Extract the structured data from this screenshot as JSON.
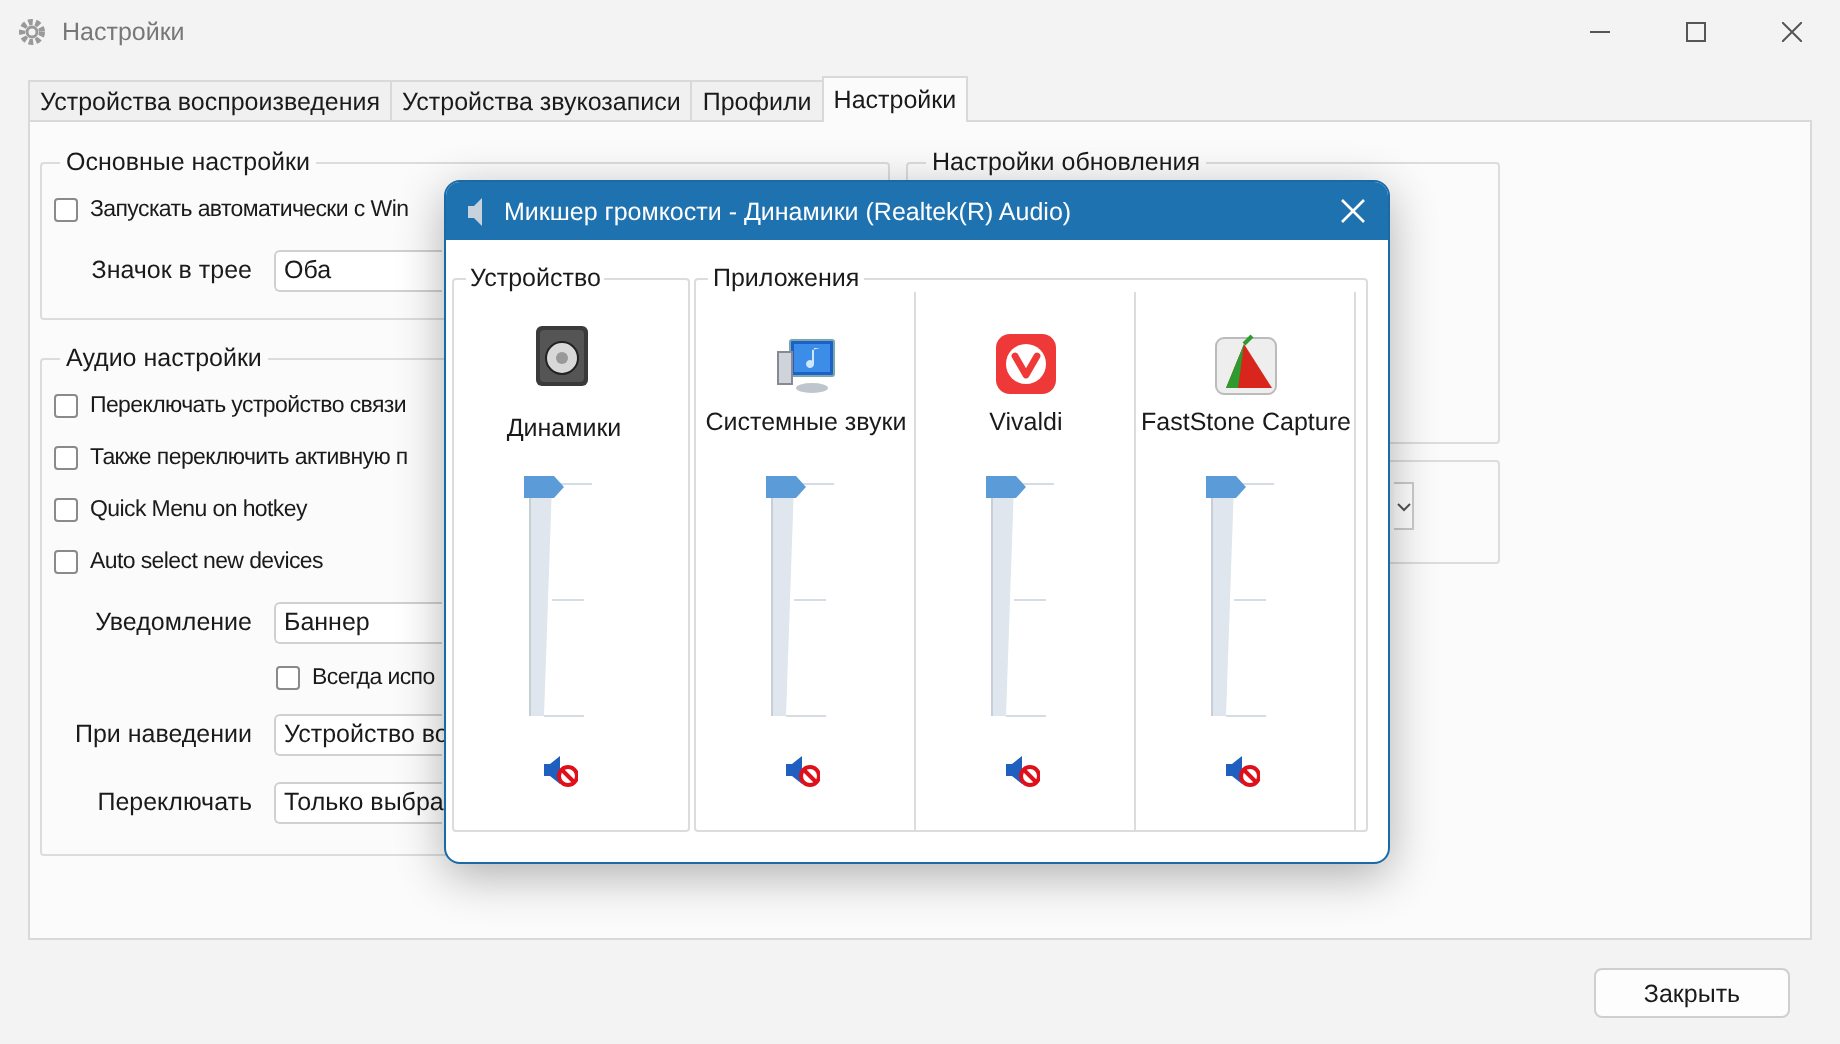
{
  "window": {
    "title": "Настройки"
  },
  "tabs": [
    {
      "label": "Устройства воспроизведения",
      "selected": false
    },
    {
      "label": "Устройства звукозаписи",
      "selected": false
    },
    {
      "label": "Профили",
      "selected": false
    },
    {
      "label": "Настройки",
      "selected": true
    }
  ],
  "main_group": {
    "title": "Основные настройки",
    "items": [
      {
        "kind": "checkbox",
        "label": "Запускать автоматически с Win",
        "checked": false
      },
      {
        "kind": "combo",
        "label": "Значок в трее",
        "value": "Оба"
      }
    ]
  },
  "audio_group": {
    "title": "Аудио настройки",
    "items": [
      {
        "kind": "checkbox",
        "label": "Переключать устройство связи",
        "checked": false
      },
      {
        "kind": "checkbox",
        "label": "Также переключить активную п",
        "checked": false
      },
      {
        "kind": "checkbox",
        "label": "Quick Menu on hotkey",
        "checked": false
      },
      {
        "kind": "checkbox",
        "label": "Auto select new devices",
        "checked": false
      },
      {
        "kind": "combo",
        "label": "Уведомление",
        "value": "Баннер"
      },
      {
        "kind": "subcheckbox",
        "label": "Всегда испо",
        "checked": false
      },
      {
        "kind": "combo",
        "label": "При наведении",
        "value": "Устройство во"
      },
      {
        "kind": "combo",
        "label": "Переключать",
        "value": "Только выбра"
      }
    ]
  },
  "update_group": {
    "title": "Настройки обновления"
  },
  "close_button": "Закрыть",
  "mixer": {
    "title": "Микшер громкости - Динамики (Realtek(R) Audio)",
    "device_group": {
      "title": "Устройство",
      "channels": [
        {
          "kind": "speaker",
          "name": "Динамики",
          "level": 1,
          "muted": true
        }
      ]
    },
    "apps_group": {
      "title": "Приложения",
      "channels": [
        {
          "kind": "system",
          "name": "Системные звуки",
          "level": 1,
          "muted": true
        },
        {
          "kind": "browser",
          "name": "Vivaldi",
          "level": 1,
          "muted": true
        },
        {
          "kind": "capture",
          "name": "FastStone Capture",
          "level": 1,
          "muted": true
        }
      ]
    }
  }
}
